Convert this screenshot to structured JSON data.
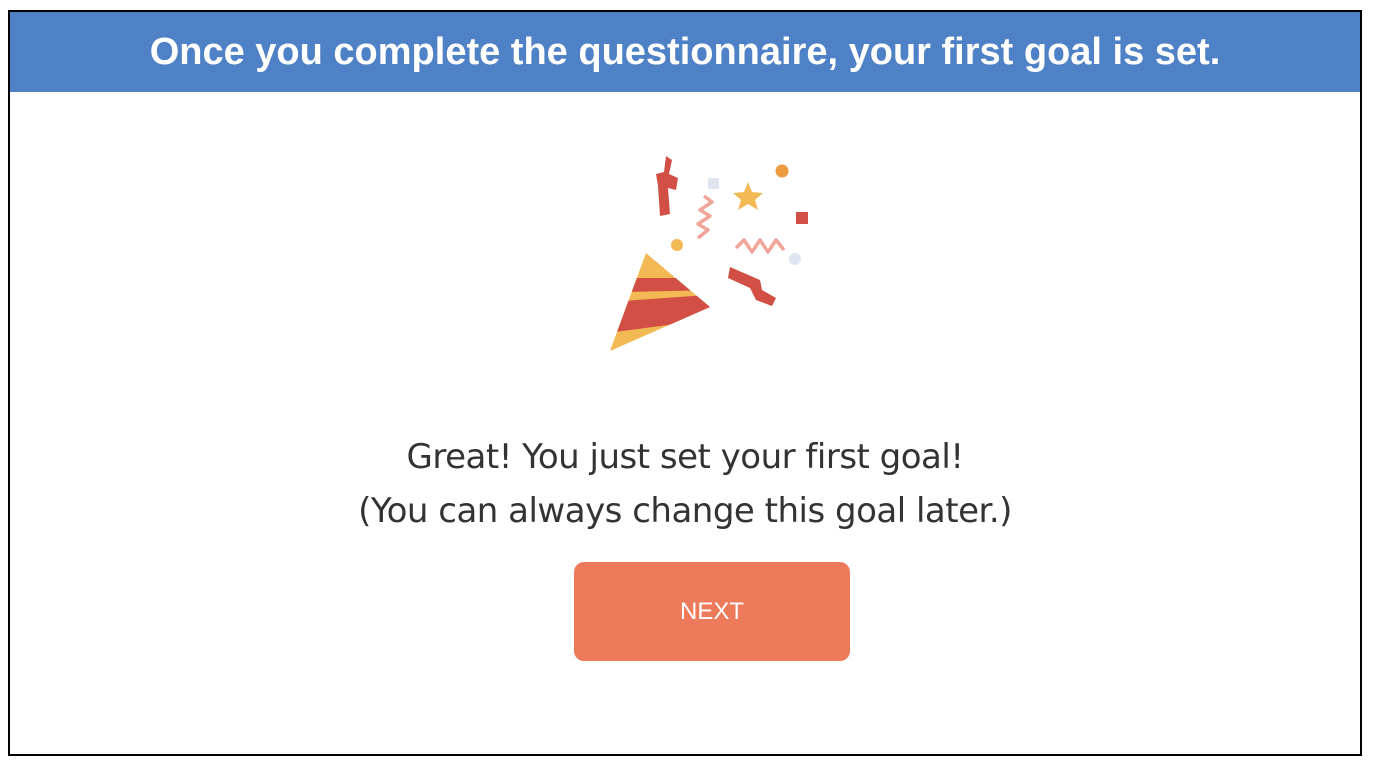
{
  "banner": {
    "title": "Once you complete the questionnaire, your first goal is set."
  },
  "illustration": {
    "icon": "party-popper-icon"
  },
  "message": {
    "line1": "Great! You just set your first goal!",
    "line2": "(You can always change this goal later.)"
  },
  "actions": {
    "next_label": "NEXT"
  },
  "colors": {
    "banner_bg": "#4f81c6",
    "button_bg": "#ee7a5c",
    "confetti_red": "#d24f45",
    "confetti_yellow": "#f2b954",
    "confetti_orange": "#ec9b40",
    "confetti_pink": "#f0a49a",
    "confetti_light": "#dfe5f0"
  }
}
